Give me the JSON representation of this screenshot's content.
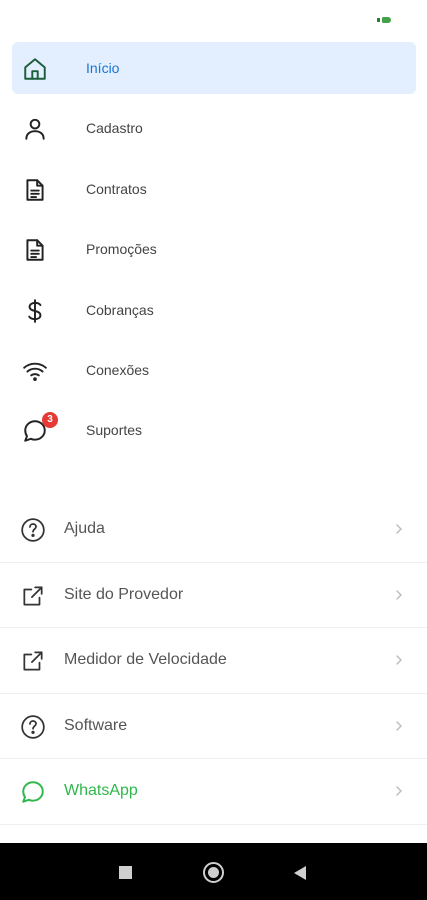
{
  "menu": {
    "items": [
      {
        "label": "Início",
        "icon": "home-icon",
        "active": true
      },
      {
        "label": "Cadastro",
        "icon": "user-icon"
      },
      {
        "label": "Contratos",
        "icon": "document-icon"
      },
      {
        "label": "Promoções",
        "icon": "document-icon"
      },
      {
        "label": "Cobranças",
        "icon": "dollar-icon"
      },
      {
        "label": "Conexões",
        "icon": "wifi-icon"
      },
      {
        "label": "Suportes",
        "icon": "chat-icon",
        "badge": "3"
      }
    ]
  },
  "links": {
    "items": [
      {
        "label": "Ajuda",
        "icon": "help-icon"
      },
      {
        "label": "Site do Provedor",
        "icon": "external-link-icon"
      },
      {
        "label": "Medidor de Velocidade",
        "icon": "external-link-icon"
      },
      {
        "label": "Software",
        "icon": "help-icon"
      },
      {
        "label": "WhatsApp",
        "icon": "whatsapp-icon"
      }
    ]
  },
  "colors": {
    "active_bg": "#e3efff",
    "active_text": "#1976d2",
    "whatsapp_green": "#2eb84b",
    "badge_red": "#e53935",
    "home_icon_green": "#1b5e3a"
  }
}
